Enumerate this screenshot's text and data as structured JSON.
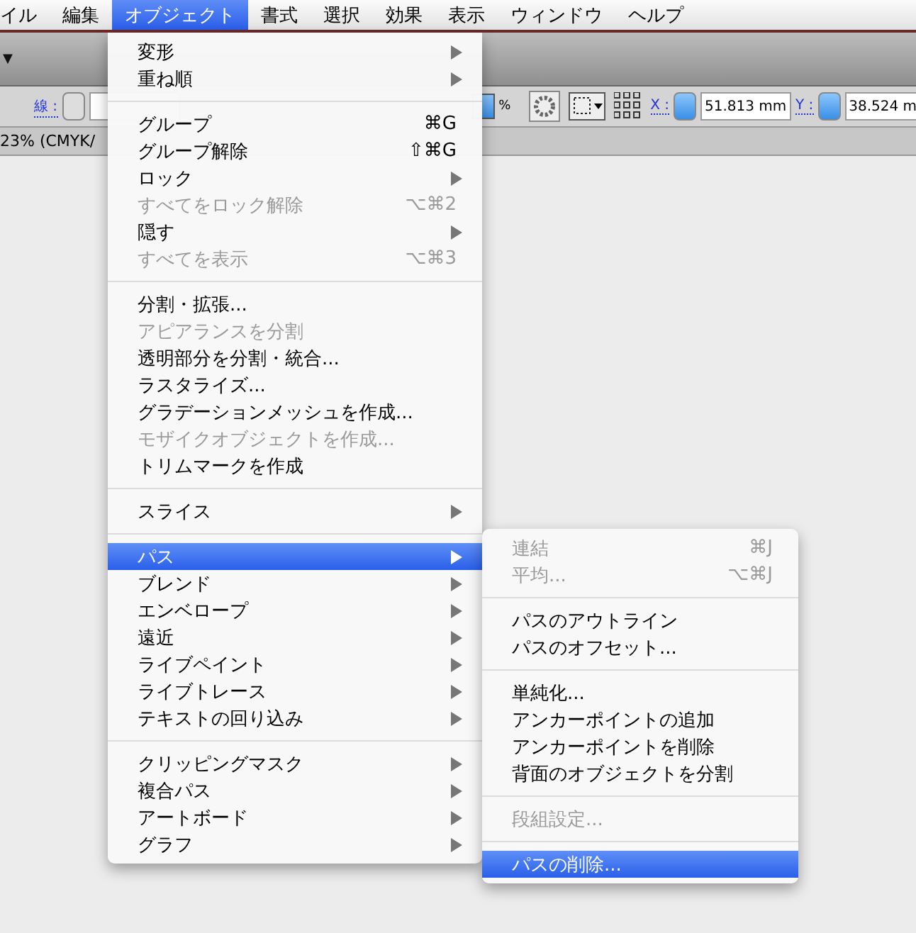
{
  "menubar": [
    {
      "label": "イル",
      "selected": false
    },
    {
      "label": "編集",
      "selected": false
    },
    {
      "label": "オブジェクト",
      "selected": true
    },
    {
      "label": "書式",
      "selected": false
    },
    {
      "label": "選択",
      "selected": false
    },
    {
      "label": "効果",
      "selected": false
    },
    {
      "label": "表示",
      "selected": false
    },
    {
      "label": "ウィンドウ",
      "selected": false
    },
    {
      "label": "ヘルプ",
      "selected": false
    }
  ],
  "toolbar": {
    "dropdown_glyph": "▼"
  },
  "control_bar": {
    "stroke_label": "線 :",
    "percent": "%",
    "x_label": "X :",
    "x_value": "51.813 mm",
    "y_label": "Y :",
    "y_value": "38.524 m"
  },
  "document_tab": "23% (CMYK/",
  "menu": {
    "groups": [
      [
        {
          "label": "変形",
          "submenu": true,
          "disabled": false,
          "selected": false
        },
        {
          "label": "重ね順",
          "submenu": true,
          "disabled": false,
          "selected": false
        }
      ],
      [
        {
          "label": "グループ",
          "shortcut": "⌘G",
          "submenu": false,
          "disabled": false,
          "selected": false
        },
        {
          "label": "グループ解除",
          "shortcut": "⇧⌘G",
          "submenu": false,
          "disabled": false,
          "selected": false
        },
        {
          "label": "ロック",
          "submenu": true,
          "disabled": false,
          "selected": false
        },
        {
          "label": "すべてをロック解除",
          "shortcut": "⌥⌘2",
          "submenu": false,
          "disabled": true,
          "selected": false
        },
        {
          "label": "隠す",
          "submenu": true,
          "disabled": false,
          "selected": false
        },
        {
          "label": "すべてを表示",
          "shortcut": "⌥⌘3",
          "submenu": false,
          "disabled": true,
          "selected": false
        }
      ],
      [
        {
          "label": "分割・拡張...",
          "submenu": false,
          "disabled": false,
          "selected": false
        },
        {
          "label": "アピアランスを分割",
          "submenu": false,
          "disabled": true,
          "selected": false
        },
        {
          "label": "透明部分を分割・統合...",
          "submenu": false,
          "disabled": false,
          "selected": false
        },
        {
          "label": "ラスタライズ...",
          "submenu": false,
          "disabled": false,
          "selected": false
        },
        {
          "label": "グラデーションメッシュを作成...",
          "submenu": false,
          "disabled": false,
          "selected": false
        },
        {
          "label": "モザイクオブジェクトを作成...",
          "submenu": false,
          "disabled": true,
          "selected": false
        },
        {
          "label": "トリムマークを作成",
          "submenu": false,
          "disabled": false,
          "selected": false
        }
      ],
      [
        {
          "label": "スライス",
          "submenu": true,
          "disabled": false,
          "selected": false
        }
      ],
      [
        {
          "label": "パス",
          "submenu": true,
          "disabled": false,
          "selected": true
        },
        {
          "label": "ブレンド",
          "submenu": true,
          "disabled": false,
          "selected": false
        },
        {
          "label": "エンベロープ",
          "submenu": true,
          "disabled": false,
          "selected": false
        },
        {
          "label": "遠近",
          "submenu": true,
          "disabled": false,
          "selected": false
        },
        {
          "label": "ライブペイント",
          "submenu": true,
          "disabled": false,
          "selected": false
        },
        {
          "label": "ライブトレース",
          "submenu": true,
          "disabled": false,
          "selected": false
        },
        {
          "label": "テキストの回り込み",
          "submenu": true,
          "disabled": false,
          "selected": false
        }
      ],
      [
        {
          "label": "クリッピングマスク",
          "submenu": true,
          "disabled": false,
          "selected": false
        },
        {
          "label": "複合パス",
          "submenu": true,
          "disabled": false,
          "selected": false
        },
        {
          "label": "アートボード",
          "submenu": true,
          "disabled": false,
          "selected": false
        },
        {
          "label": "グラフ",
          "submenu": true,
          "disabled": false,
          "selected": false
        }
      ]
    ]
  },
  "submenu": {
    "groups": [
      [
        {
          "label": "連結",
          "shortcut": "⌘J",
          "submenu": false,
          "disabled": true,
          "selected": false
        },
        {
          "label": "平均...",
          "shortcut": "⌥⌘J",
          "submenu": false,
          "disabled": true,
          "selected": false
        }
      ],
      [
        {
          "label": "パスのアウトライン",
          "submenu": false,
          "disabled": false,
          "selected": false
        },
        {
          "label": "パスのオフセット...",
          "submenu": false,
          "disabled": false,
          "selected": false
        }
      ],
      [
        {
          "label": "単純化...",
          "submenu": false,
          "disabled": false,
          "selected": false
        },
        {
          "label": "アンカーポイントの追加",
          "submenu": false,
          "disabled": false,
          "selected": false
        },
        {
          "label": "アンカーポイントを削除",
          "submenu": false,
          "disabled": false,
          "selected": false
        },
        {
          "label": "背面のオブジェクトを分割",
          "submenu": false,
          "disabled": false,
          "selected": false
        }
      ],
      [
        {
          "label": "段組設定...",
          "submenu": false,
          "disabled": true,
          "selected": false
        }
      ],
      [
        {
          "label": "パスの削除...",
          "submenu": false,
          "disabled": false,
          "selected": true
        }
      ]
    ]
  }
}
